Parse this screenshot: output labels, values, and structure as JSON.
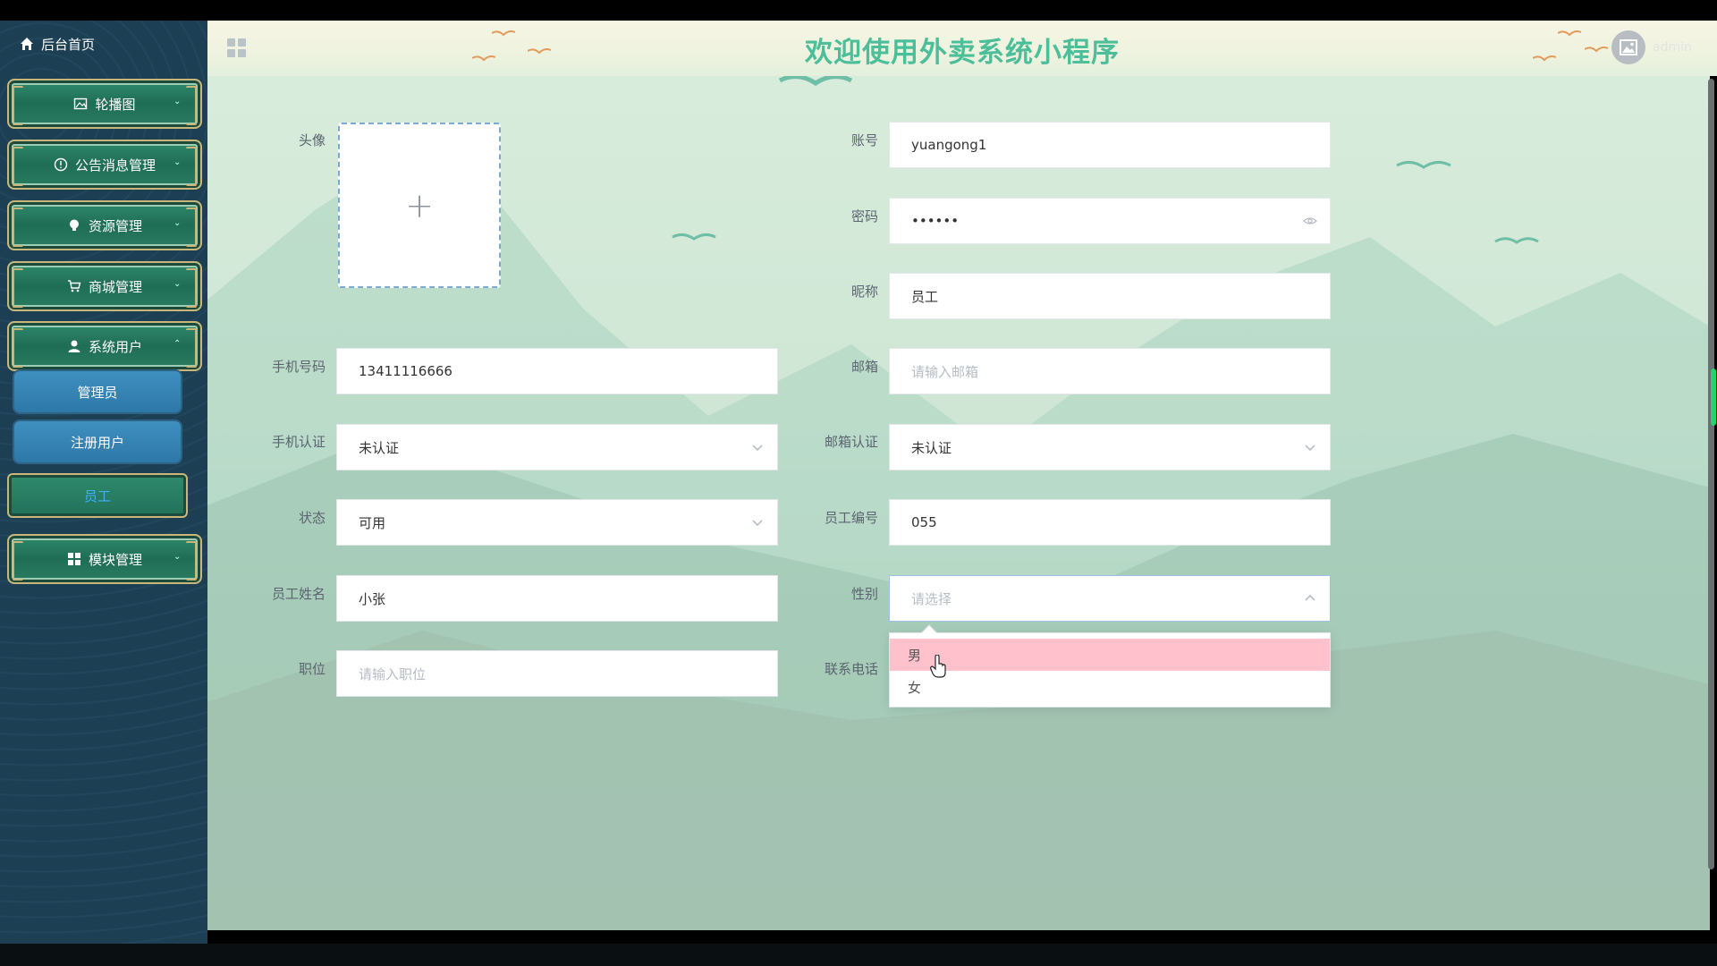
{
  "header": {
    "title": "欢迎使用外卖系统小程序",
    "username": "admin"
  },
  "sidebar": {
    "home_label": "后台首页",
    "items": [
      {
        "label": "轮播图",
        "icon": "image-icon"
      },
      {
        "label": "公告消息管理",
        "icon": "info-icon"
      },
      {
        "label": "资源管理",
        "icon": "bulb-icon"
      },
      {
        "label": "商城管理",
        "icon": "cart-icon"
      },
      {
        "label": "系统用户",
        "icon": "user-icon"
      },
      {
        "label": "模块管理",
        "icon": "grid-icon"
      }
    ],
    "subitems": [
      {
        "label": "管理员"
      },
      {
        "label": "注册用户"
      },
      {
        "label": "员工"
      }
    ]
  },
  "form": {
    "avatar_label": "头像",
    "account_label": "账号",
    "account_value": "yuangong1",
    "password_label": "密码",
    "password_value": "••••••",
    "nickname_label": "昵称",
    "nickname_value": "员工",
    "phone_label": "手机号码",
    "phone_value": "13411116666",
    "email_label": "邮箱",
    "email_placeholder": "请输入邮箱",
    "phone_verify_label": "手机认证",
    "phone_verify_value": "未认证",
    "email_verify_label": "邮箱认证",
    "email_verify_value": "未认证",
    "status_label": "状态",
    "status_value": "可用",
    "employee_no_label": "员工编号",
    "employee_no_value": "055",
    "employee_name_label": "员工姓名",
    "employee_name_value": "小张",
    "gender_label": "性别",
    "gender_placeholder": "请选择",
    "position_label": "职位",
    "position_placeholder": "请输入职位",
    "contact_label": "联系电话"
  },
  "gender_dropdown": {
    "options": [
      "男",
      "女"
    ],
    "hovered_option": "男"
  }
}
